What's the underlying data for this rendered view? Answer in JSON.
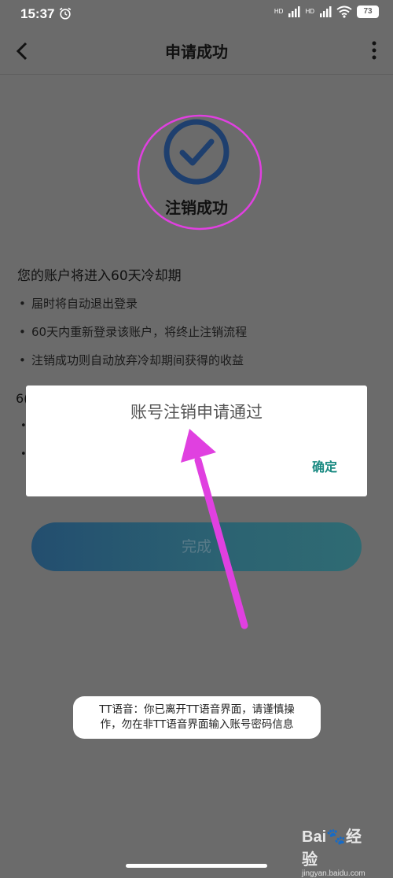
{
  "status_bar": {
    "time": "15:37",
    "battery": "73",
    "signal1_tag": "HD",
    "signal2_tag": "HD",
    "icons": [
      "alarm-icon",
      "signal-icon",
      "signal-icon",
      "wifi-icon",
      "battery-icon"
    ]
  },
  "nav": {
    "title": "申请成功",
    "back_icon": "chevron-left-icon",
    "more_icon": "more-vertical-icon"
  },
  "success": {
    "label": "注销成功",
    "icon": "check-circle-icon"
  },
  "info": {
    "title": "您的账户将进入60天冷却期",
    "items": [
      "届时将自动退出登录",
      "60天内重新登录该账户，将终止注销流程",
      "注销成功则自动放弃冷却期间获得的收益"
    ],
    "partial_line_prefix": "6(",
    "bullet": "•"
  },
  "done_button": {
    "label": "完成"
  },
  "dialog": {
    "message": "账号注销申请通过",
    "confirm": "确定"
  },
  "toast": {
    "line1": "TT语音：你已离开TT语音界面，请谨慎操",
    "line2": "作，勿在非TT语音界面输入账号密码信息"
  },
  "watermark": {
    "logo": "Bai🐾经验",
    "sub": "jingyan.baidu.com"
  },
  "colors": {
    "overlay_bg": "#6b6b6b",
    "accent_teal": "#1a8a82",
    "annotation_magenta": "#e040e0",
    "check_blue": "#1e3f6e"
  }
}
